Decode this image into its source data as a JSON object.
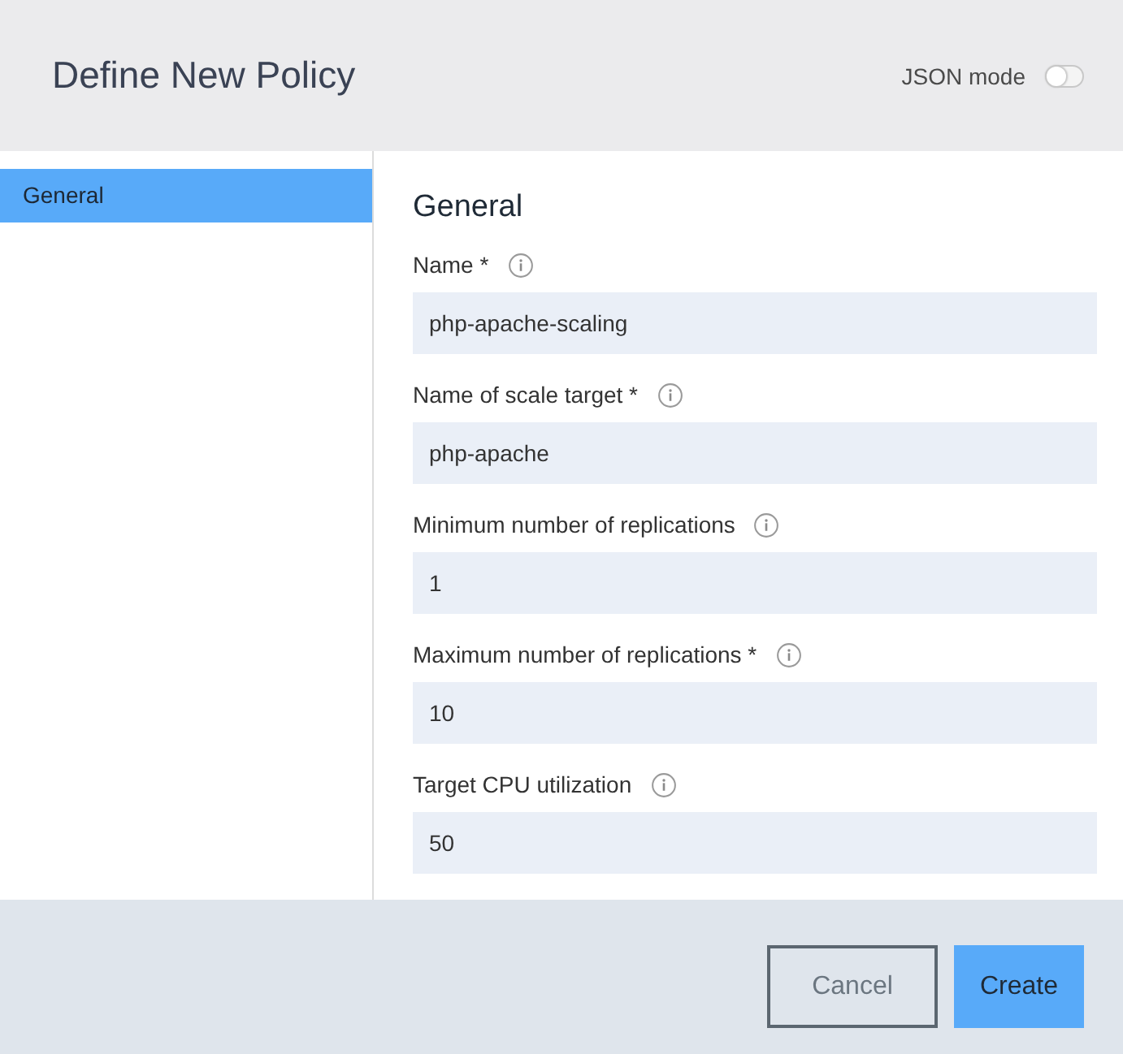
{
  "dialog": {
    "title": "Define New Policy",
    "json_mode": {
      "label": "JSON mode",
      "on": false
    }
  },
  "sidebar": {
    "items": [
      {
        "label": "General",
        "selected": true
      }
    ]
  },
  "section": {
    "title": "General",
    "fields": [
      {
        "label": "Name *",
        "value": "php-apache-scaling"
      },
      {
        "label": "Name of scale target *",
        "value": "php-apache"
      },
      {
        "label": "Minimum number of replications",
        "value": "1"
      },
      {
        "label": "Maximum number of replications *",
        "value": "10"
      },
      {
        "label": "Target CPU utilization",
        "value": "50"
      }
    ]
  },
  "buttons": [
    {
      "label": "Cancel",
      "kind": "secondary"
    },
    {
      "label": "Create",
      "kind": "primary"
    }
  ]
}
